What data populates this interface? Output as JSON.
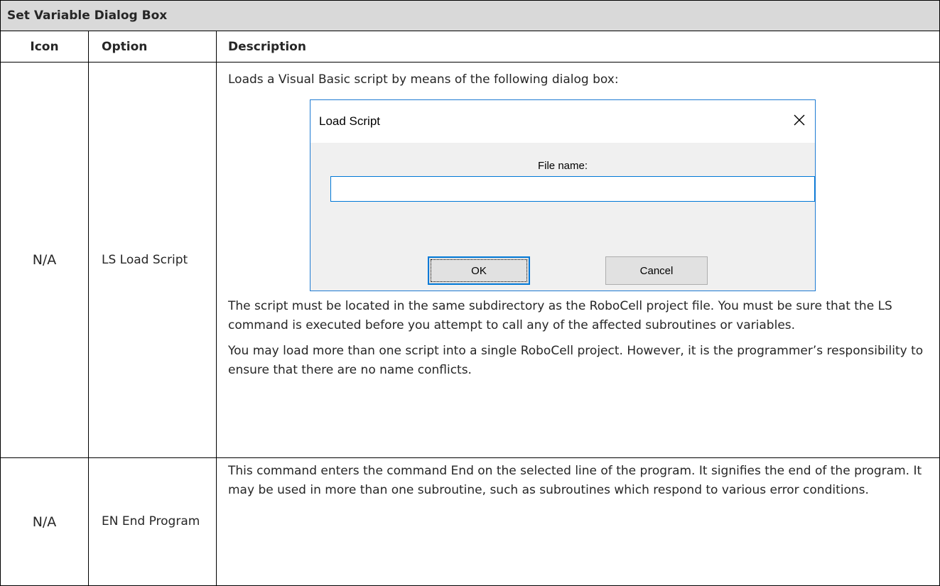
{
  "table": {
    "caption": "Set Variable Dialog Box",
    "headers": {
      "icon": "Icon",
      "option": "Option",
      "description": "Description"
    },
    "rows": [
      {
        "icon": "N/A",
        "option": "LS Load Script",
        "intro": "Loads a Visual Basic script by means of the following dialog box:",
        "para1": "The script must be located in the same subdirectory as the RoboCell project file. You must be sure that the LS command is executed before you attempt to call any of the affected subroutines or variables.",
        "para2": "You may load more than one script into a single RoboCell project. However, it is the programmer’s responsibility to ensure that there are no name conflicts."
      },
      {
        "icon": "N/A",
        "option": "EN End Program",
        "description": "This command enters the command End on the selected line of the program. It signifies the end of the program. It may be used in more than one subroutine, such as subroutines which respond to various error conditions."
      }
    ]
  },
  "dialog": {
    "title": "Load Script",
    "file_label": "File name:",
    "file_value": "",
    "ok_label": "OK",
    "cancel_label": "Cancel",
    "close_icon": "close-icon"
  }
}
